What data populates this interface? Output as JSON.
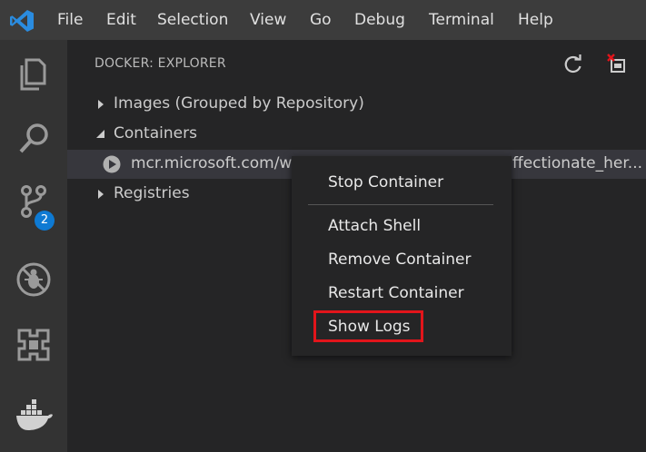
{
  "menubar": {
    "items": [
      "File",
      "Edit",
      "Selection",
      "View",
      "Go",
      "Debug",
      "Terminal",
      "Help"
    ]
  },
  "activity_bar": {
    "icons": [
      "explorer-icon",
      "search-icon",
      "source-control-icon",
      "debug-icon",
      "extensions-icon",
      "docker-icon"
    ],
    "source_control_badge": "2"
  },
  "sidebar": {
    "title": "DOCKER: EXPLORER",
    "actions": [
      "refresh-icon",
      "prune-icon"
    ],
    "tree": {
      "images": "Images (Grouped by Repository)",
      "containers": "Containers",
      "container_item_left": "mcr.microsoft.com/wi",
      "container_item_right": "ffectionate_her...",
      "registries": "Registries"
    }
  },
  "context_menu": {
    "items": [
      "Stop Container",
      "Attach Shell",
      "Remove Container",
      "Restart Container",
      "Show Logs"
    ],
    "highlighted": "Show Logs",
    "highlight_color": "#e2151b"
  },
  "colors": {
    "accent": "#0e7ad3",
    "menubar_bg": "#3c3c3c",
    "activitybar_bg": "#333333",
    "sidebar_bg": "#252526"
  }
}
